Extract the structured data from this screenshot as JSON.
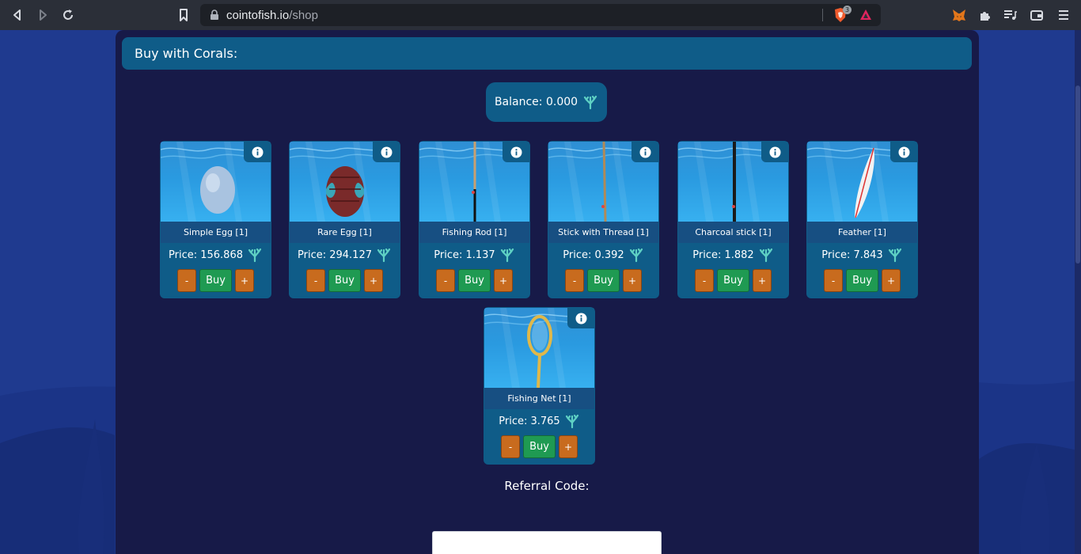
{
  "browser": {
    "url_domain": "cointofish.io",
    "url_path": "/shop",
    "shield_count": "3"
  },
  "shop": {
    "header": "Buy with Corals:",
    "balance_label": "Balance: 0.000",
    "currency_icon": "coral-icon",
    "minus_label": "-",
    "buy_label": "Buy",
    "plus_label": "+",
    "items": [
      {
        "name": "Simple Egg [1]",
        "price": "Price: 156.868",
        "image": "simple-egg"
      },
      {
        "name": "Rare Egg [1]",
        "price": "Price: 294.127",
        "image": "rare-egg"
      },
      {
        "name": "Fishing Rod [1]",
        "price": "Price: 1.137",
        "image": "fishing-rod"
      },
      {
        "name": "Stick with Thread [1]",
        "price": "Price: 0.392",
        "image": "stick-with-thread"
      },
      {
        "name": "Charcoal stick [1]",
        "price": "Price: 1.882",
        "image": "charcoal-stick"
      },
      {
        "name": "Feather [1]",
        "price": "Price: 7.843",
        "image": "feather"
      },
      {
        "name": "Fishing Net [1]",
        "price": "Price: 3.765",
        "image": "fishing-net"
      }
    ],
    "referral_label": "Referral Code:",
    "referral_value": ""
  },
  "colors": {
    "page_bg": "#1f3a8f",
    "panel_bg": "#171a48",
    "header_bg": "#0f5c88",
    "buy_button": "#1f9a52",
    "qty_button": "#c86b1e"
  }
}
